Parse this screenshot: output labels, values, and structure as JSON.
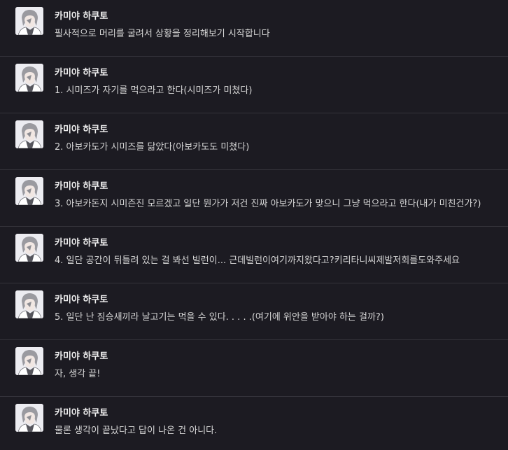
{
  "messages": [
    {
      "author": "카미야 하쿠토",
      "avatar": "character-avatar-icon",
      "text": "필사적으로 머리를 굴려서 상황을 정리해보기 시작합니다"
    },
    {
      "author": "카미야 하쿠토",
      "avatar": "character-avatar-icon",
      "text": "1. 시미즈가 자기를 먹으라고 한다(시미즈가 미쳤다)"
    },
    {
      "author": "카미야 하쿠토",
      "avatar": "character-avatar-icon",
      "text": "2. 아보카도가 시미즈를 닮았다(아보카도도 미쳤다)"
    },
    {
      "author": "카미야 하쿠토",
      "avatar": "character-avatar-icon",
      "text": "3. 아보카돈지 시미즌진 모르겠고 일단 뭔가가 저건 진짜 아보카도가 맞으니 그냥 먹으라고 한다(내가 미친건가?)"
    },
    {
      "author": "카미야 하쿠토",
      "avatar": "character-avatar-icon",
      "text": "4. 일단 공간이 뒤틀려 있는 걸 봐선 빌런이... 근데빌런이여기까지왔다고?키리타니씨제발저회를도와주세요"
    },
    {
      "author": "카미야 하쿠토",
      "avatar": "character-avatar-icon",
      "text": "5. 일단 난 짐승새끼라 날고기는 먹을 수 있다. . . . .(여기에 위안을 받아야 하는 걸까?)"
    },
    {
      "author": "카미야 하쿠토",
      "avatar": "character-avatar-icon",
      "text": "자, 생각 끝!"
    },
    {
      "author": "카미야 하쿠토",
      "avatar": "character-avatar-icon",
      "text": "물론 생각이 끝났다고 답이 나온 건 아니다."
    }
  ],
  "colors": {
    "background": "#1c1b22",
    "divider": "#34333b",
    "name": "#f0f0f0",
    "text": "#d6d6d6"
  }
}
